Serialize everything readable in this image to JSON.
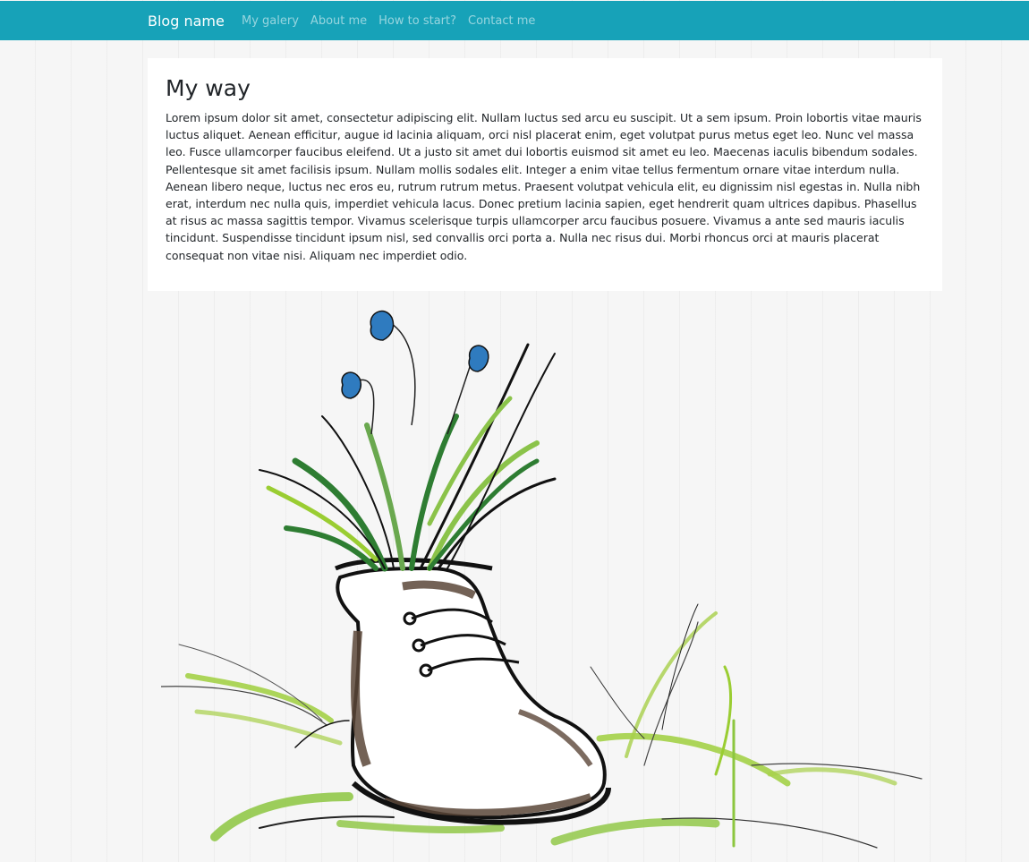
{
  "navbar": {
    "brand": "Blog name",
    "links": [
      "My galery",
      "About me",
      "How to start?",
      "Contact me"
    ],
    "background": "#17a2b8"
  },
  "article": {
    "title": "My way",
    "body": "Lorem ipsum dolor sit amet, consectetur adipiscing elit. Nullam luctus sed arcu eu suscipit. Ut a sem ipsum. Proin lobortis vitae mauris luctus aliquet. Aenean efficitur, augue id lacinia aliquam, orci nisl placerat enim, eget volutpat purus metus eget leo. Nunc vel massa leo. Fusce ullamcorper faucibus eleifend. Ut a justo sit amet dui lobortis euismod sit amet eu leo. Maecenas iaculis bibendum sodales. Pellentesque sit amet facilisis ipsum. Nullam mollis sodales elit. Integer a enim vitae tellus fermentum ornare vitae interdum nulla. Aenean libero neque, luctus nec eros eu, rutrum rutrum metus. Praesent volutpat vehicula elit, eu dignissim nisl egestas in. Nulla nibh erat, interdum nec nulla quis, imperdiet vehicula lacus. Donec pretium lacinia sapien, eget hendrerit quam ultrices dapibus. Phasellus at risus ac massa sagittis tempor. Vivamus scelerisque turpis ullamcorper arcu faucibus posuere. Vivamus a ante sed mauris iaculis tincidunt. Suspendisse tincidunt ipsum nisl, sed convallis orci porta a. Nulla nec risus dui. Morbi rhoncus orci at mauris placerat consequat non vitae nisi. Aliquam nec imperdiet odio."
  },
  "illustration": {
    "icon": "boot-with-grass-and-flowers-illustration"
  }
}
